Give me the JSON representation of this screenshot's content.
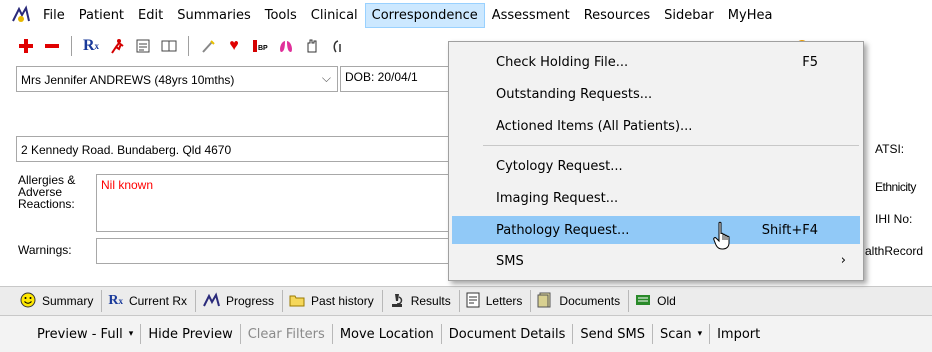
{
  "menubar": {
    "items": [
      "File",
      "Patient",
      "Edit",
      "Summaries",
      "Tools",
      "Clinical",
      "Correspondence",
      "Assessment",
      "Resources",
      "Sidebar",
      "MyHea"
    ],
    "active_index": 6
  },
  "patient": {
    "name_select": "Mrs Jennifer ANDREWS (48yrs 10mths)",
    "dob": "DOB: 20/04/1",
    "address": "2 Kennedy Road. Bundaberg. Qld  4670",
    "allergies_label": "Allergies & Adverse Reactions:",
    "allergies_value": "Nil known",
    "warnings_label": "Warnings:"
  },
  "right_panel": {
    "atsi": "ATSI:",
    "ethnicity": "Ethnicity",
    "ihi": "IHI No:",
    "health_record": "althRecord"
  },
  "dropdown": {
    "items": [
      {
        "label": "Check Holding File...",
        "shortcut": "F5"
      },
      {
        "label": "Outstanding Requests...",
        "shortcut": ""
      },
      {
        "label": "Actioned Items (All Patients)...",
        "shortcut": ""
      },
      {
        "label": "Cytology Request...",
        "shortcut": ""
      },
      {
        "label": "Imaging Request...",
        "shortcut": ""
      },
      {
        "label": "Pathology Request...",
        "shortcut": "Shift+F4"
      },
      {
        "label": "SMS",
        "shortcut": ""
      }
    ],
    "highlighted_index": 5,
    "submenu_arrow": "›"
  },
  "tabs": [
    {
      "label": "Summary",
      "icon": "smiley-icon"
    },
    {
      "label": "Current Rx",
      "icon": "rx-icon"
    },
    {
      "label": "Progress",
      "icon": "progress-icon"
    },
    {
      "label": "Past history",
      "icon": "folder-icon"
    },
    {
      "label": "Results",
      "icon": "microscope-icon"
    },
    {
      "label": "Letters",
      "icon": "letter-icon"
    },
    {
      "label": "Documents",
      "icon": "documents-icon"
    },
    {
      "label": "Old",
      "icon": "old-icon"
    }
  ],
  "actions": [
    {
      "label": "Preview - Full",
      "dropdown": true,
      "disabled": false
    },
    {
      "label": "Hide Preview",
      "dropdown": false,
      "disabled": false
    },
    {
      "label": "Clear Filters",
      "dropdown": false,
      "disabled": true
    },
    {
      "label": "Move Location",
      "dropdown": false,
      "disabled": false
    },
    {
      "label": "Document Details",
      "dropdown": false,
      "disabled": false
    },
    {
      "label": "Send SMS",
      "dropdown": false,
      "disabled": false
    },
    {
      "label": "Scan",
      "dropdown": true,
      "disabled": false
    },
    {
      "label": "Import",
      "dropdown": false,
      "disabled": false
    }
  ],
  "dropdown_arrow": "▾",
  "select_chevron": "⌵",
  "toolbar": {
    "rx_glyph": "R",
    "rx_sub": "x"
  },
  "colors": {
    "menu_active_bg": "#cce8ff",
    "dropdown_highlight": "#91c9f7",
    "allergy_text": "#ff0000"
  }
}
